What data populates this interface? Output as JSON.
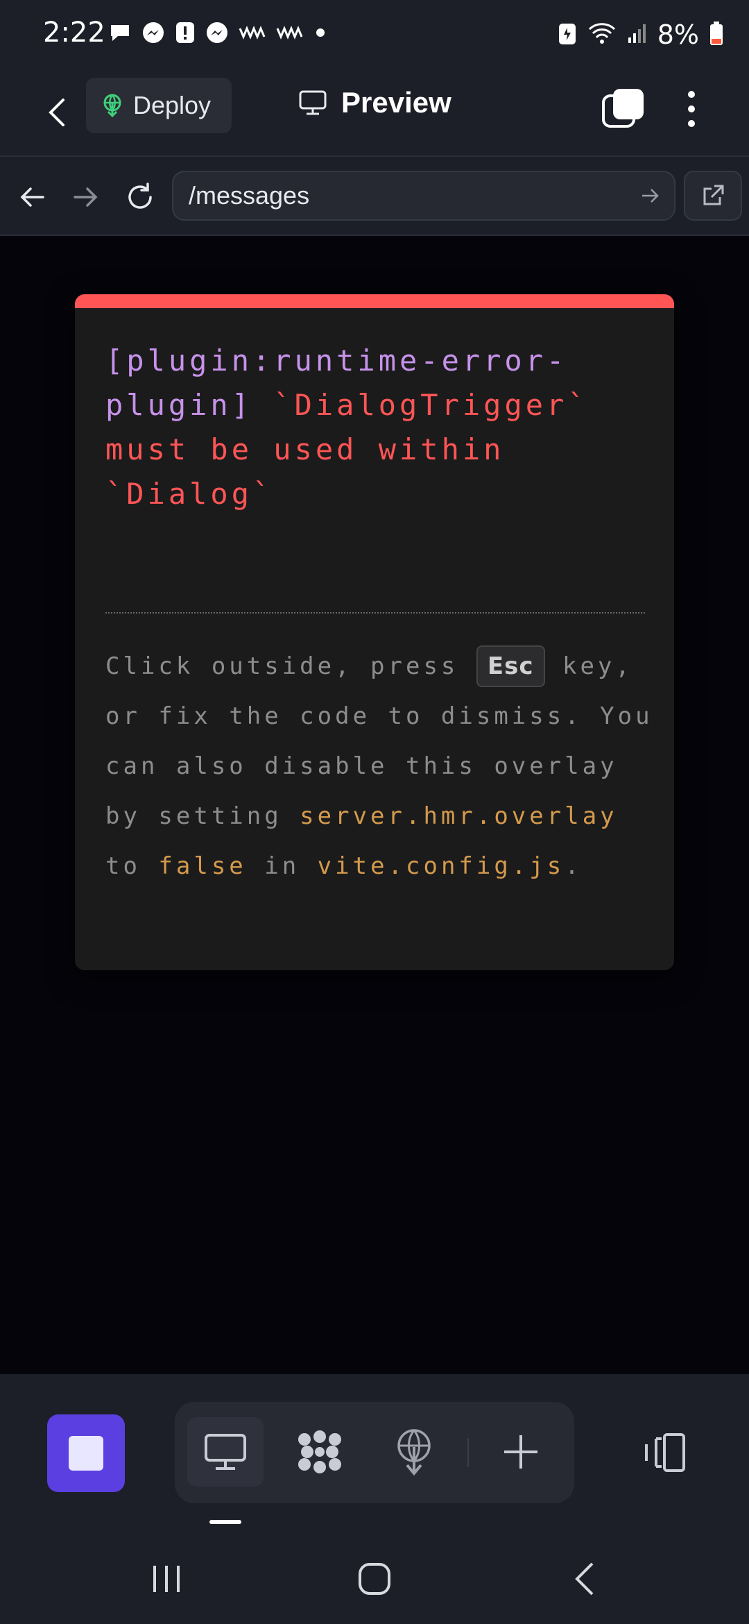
{
  "status_bar": {
    "time": "2:22",
    "battery_percent": "8%",
    "notification_icons": [
      "chat-bubble-icon",
      "messenger-icon",
      "alert-icon",
      "messenger-icon",
      "wavy-icon",
      "wavy-icon",
      "dot-icon"
    ],
    "system_icons": [
      "battery-saver-icon",
      "wifi-icon",
      "signal-icon",
      "battery-icon"
    ]
  },
  "header": {
    "deploy_label": "Deploy",
    "preview_label": "Preview"
  },
  "url_bar": {
    "value": "/messages"
  },
  "error_overlay": {
    "plugin_tag": "[plugin:runtime-error-plugin]",
    "message": " `DialogTrigger` must be used within `Dialog`",
    "tip": {
      "part1": "Click outside, press ",
      "key": "Esc",
      "part2": " key, or fix the code to dismiss. You can also disable this overlay by setting ",
      "code1": "server.hmr.overlay",
      "part3": " to ",
      "code2": "false",
      "part4": " in ",
      "code3": "vite.config.js",
      "part5": "."
    },
    "colors": {
      "stripe": "#ff5555",
      "plugin": "#c792ea",
      "error": "#ff5555",
      "code": "#d49a4c",
      "tip": "#8d8d8d"
    }
  },
  "toolbar": {
    "stop_button_color": "#5b3fe0",
    "tools": [
      "desktop-icon",
      "agent-icon",
      "deploy-icon",
      "plus-icon"
    ],
    "panel_icon": "panel-toggle-icon"
  }
}
